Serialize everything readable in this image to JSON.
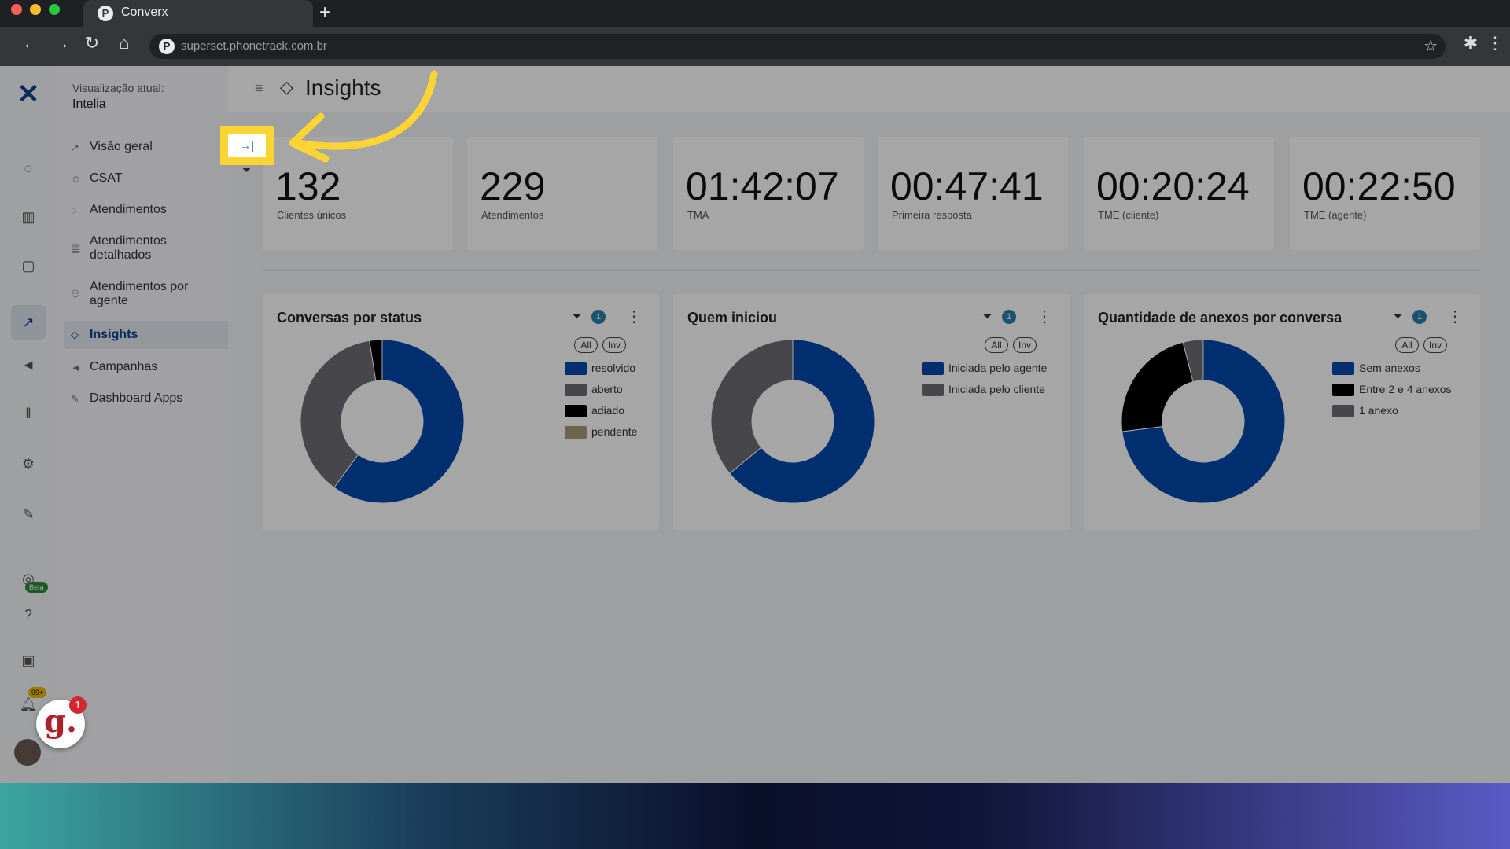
{
  "browser": {
    "tab_title": "Converx",
    "tab_favicon": "P",
    "new_tab": "+",
    "url": "superset.phonetrack.com.br"
  },
  "sidebar": {
    "view_label": "Visualização atual:",
    "view_value": "Intelia",
    "items": [
      {
        "label": "Visão geral",
        "icon": "chart-line-icon"
      },
      {
        "label": "CSAT",
        "icon": "smile-icon"
      },
      {
        "label": "Atendimentos",
        "icon": "chat-icon"
      },
      {
        "label": "Atendimentos detalhados",
        "icon": "list-detail-icon"
      },
      {
        "label": "Atendimentos por agente",
        "icon": "users-icon"
      },
      {
        "label": "Insights",
        "icon": "tag-icon"
      },
      {
        "label": "Campanhas",
        "icon": "megaphone-icon"
      },
      {
        "label": "Dashboard Apps",
        "icon": "rocket-icon"
      }
    ]
  },
  "header": {
    "title": "Insights"
  },
  "collapse_button": "→|",
  "kpis": [
    {
      "value": "132",
      "label": "Clientes únicos"
    },
    {
      "value": "229",
      "label": "Atendimentos"
    },
    {
      "value": "01:42:07",
      "label": "TMA"
    },
    {
      "value": "00:47:41",
      "label": "Primeira resposta"
    },
    {
      "value": "00:20:24",
      "label": "TME (cliente)"
    },
    {
      "value": "00:22:50",
      "label": "TME (agente)"
    }
  ],
  "pill_all": "All",
  "pill_inv": "Inv",
  "filter_count": "1",
  "notifications_count": "99+",
  "beta_label": "Beta",
  "g_badge": "g.",
  "g_badge_count": "1",
  "colors": {
    "blue": "#0047ab",
    "gray": "#6e6e73",
    "black": "#000000",
    "tan": "#a89a7a",
    "highlight": "#fcd535"
  },
  "chart_data": [
    {
      "type": "pie",
      "title": "Conversas por status",
      "categories": [
        "resolvido",
        "aberto",
        "adiado",
        "pendente"
      ],
      "values": [
        60,
        37.5,
        2.5,
        0
      ],
      "colors": [
        "#0047ab",
        "#6e6e73",
        "#000000",
        "#a89a7a"
      ]
    },
    {
      "type": "pie",
      "title": "Quem iniciou",
      "categories": [
        "Iniciada pelo agente",
        "Iniciada pelo cliente"
      ],
      "values": [
        64,
        36
      ],
      "colors": [
        "#0047ab",
        "#6e6e73"
      ]
    },
    {
      "type": "pie",
      "title": "Quantidade de anexos por conversa",
      "categories": [
        "Sem anexos",
        "Entre 2 e 4 anexos",
        "1 anexo"
      ],
      "values": [
        73,
        23,
        4
      ],
      "colors": [
        "#0047ab",
        "#000000",
        "#6e6e73"
      ]
    }
  ]
}
